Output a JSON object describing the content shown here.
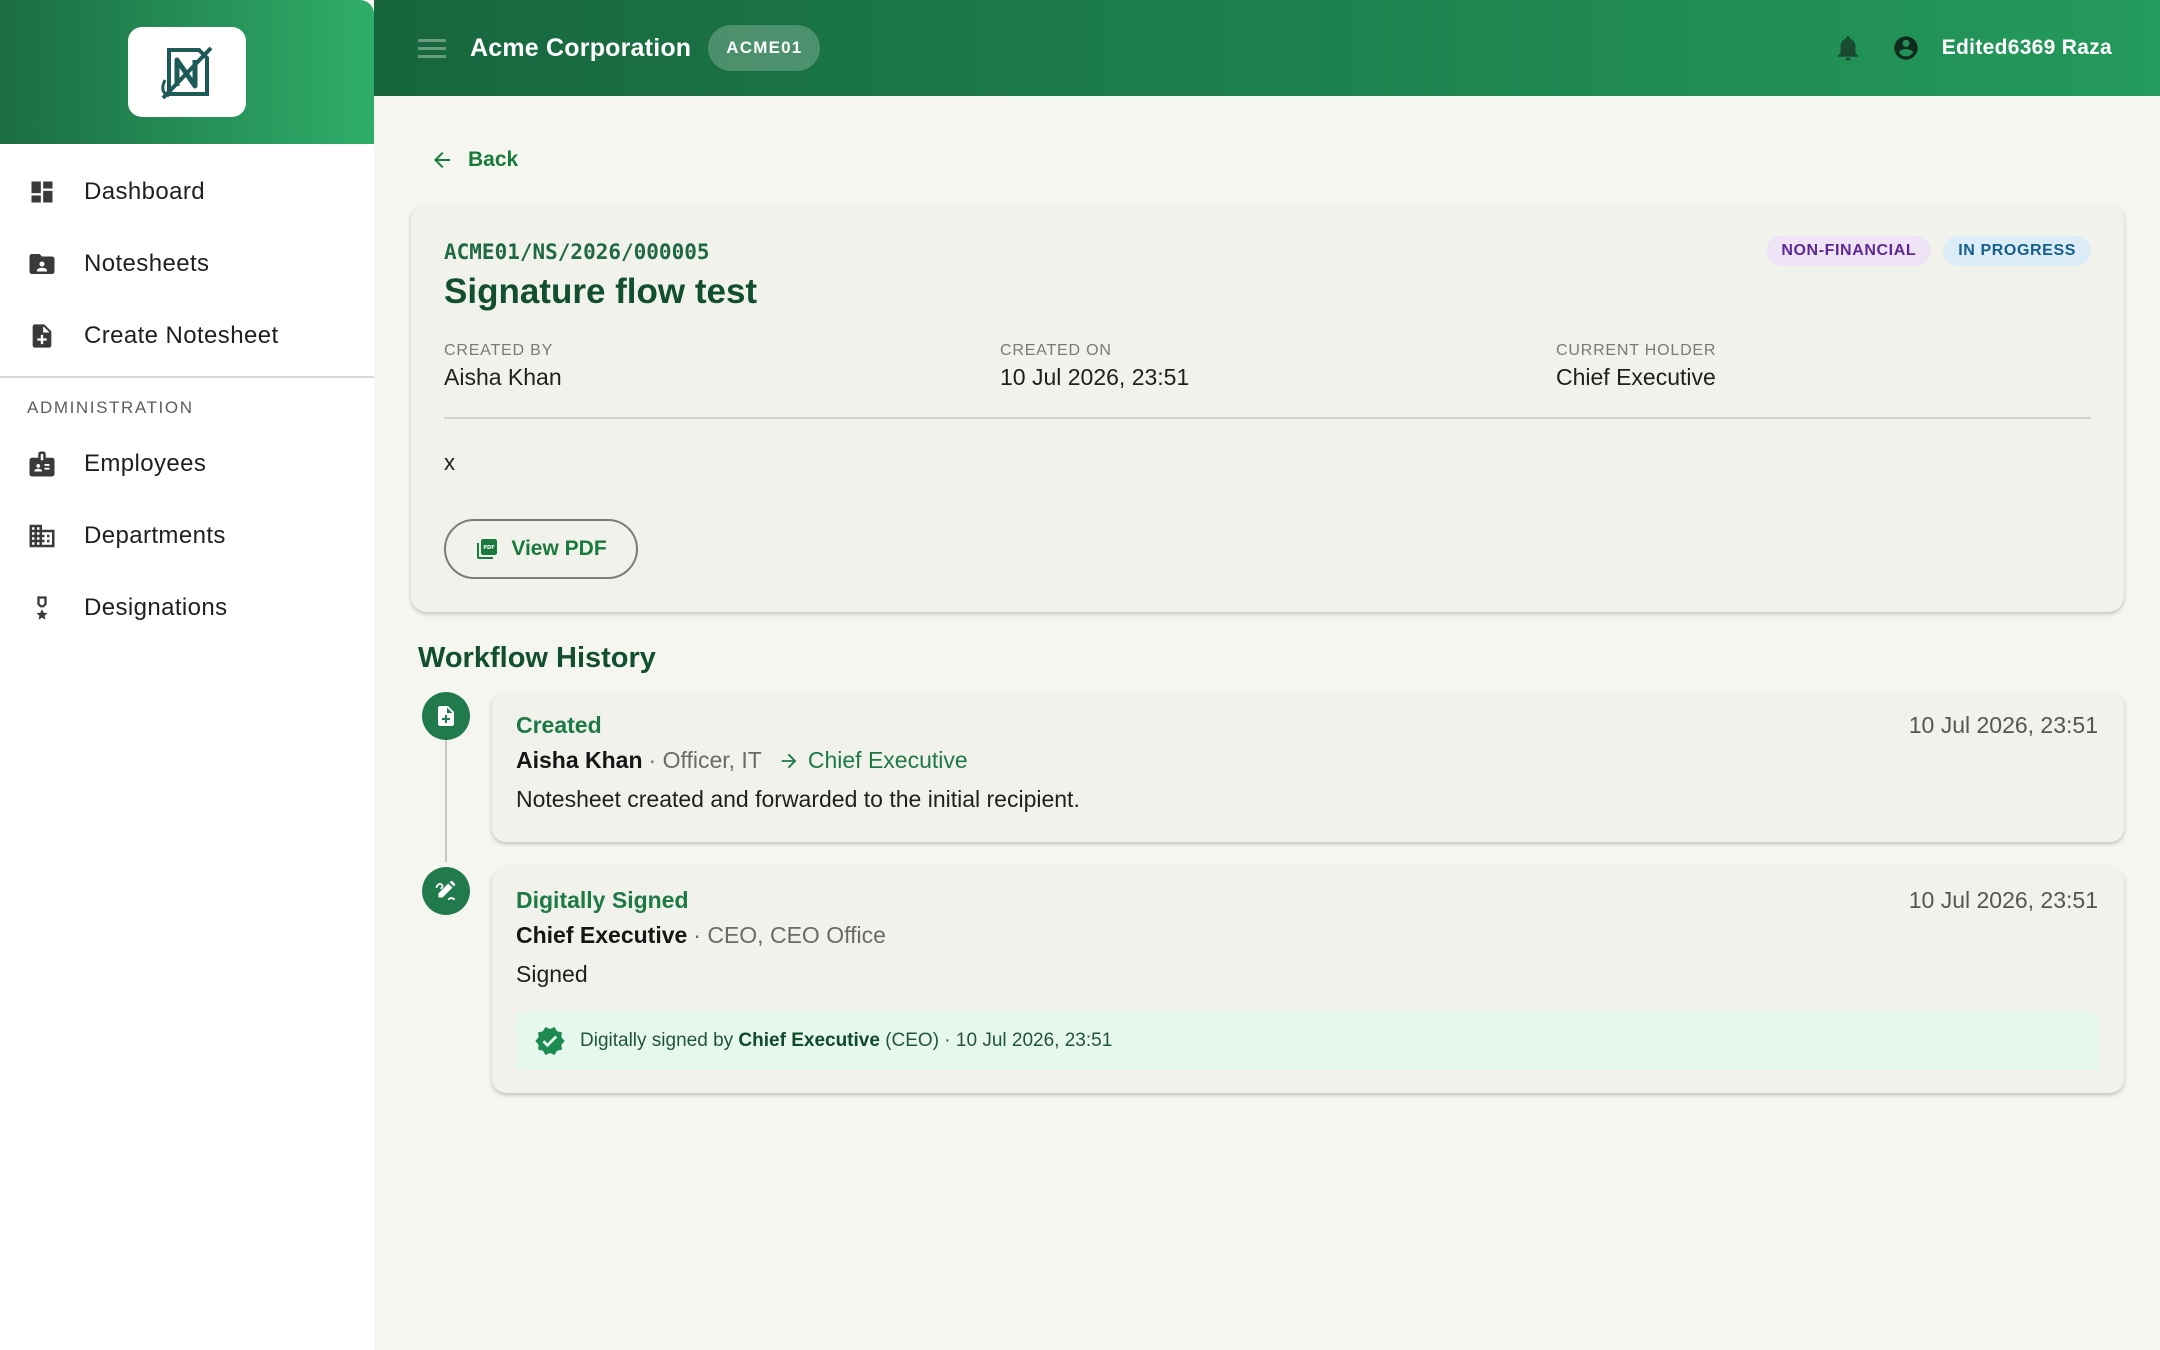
{
  "sidebar": {
    "items": [
      {
        "label": "Dashboard",
        "icon": "dashboard-icon"
      },
      {
        "label": "Notesheets",
        "icon": "folder-user-icon"
      },
      {
        "label": "Create Notesheet",
        "icon": "note-add-icon"
      }
    ],
    "section_label": "ADMINISTRATION",
    "admin_items": [
      {
        "label": "Employees",
        "icon": "badge-icon"
      },
      {
        "label": "Departments",
        "icon": "building-icon"
      },
      {
        "label": "Designations",
        "icon": "medal-icon"
      }
    ]
  },
  "topbar": {
    "org_name": "Acme Corporation",
    "org_code": "ACME01",
    "user_name": "Edited6369 Raza"
  },
  "back_label": "Back",
  "notesheet": {
    "reference": "ACME01/NS/2026/000005",
    "title": "Signature flow test",
    "badges": {
      "type": "NON-FINANCIAL",
      "status": "IN PROGRESS"
    },
    "meta": {
      "created_by_label": "CREATED BY",
      "created_by": "Aisha Khan",
      "created_on_label": "CREATED ON",
      "created_on": "10 Jul 2026, 23:51",
      "holder_label": "CURRENT HOLDER",
      "holder": "Chief Executive"
    },
    "body": "x",
    "view_pdf_label": "View PDF"
  },
  "workflow": {
    "title": "Workflow History",
    "events": [
      {
        "action": "Created",
        "time": "10 Jul 2026, 23:51",
        "actor": "Aisha Khan",
        "actor_role": "· Officer, IT",
        "forwarded_to": "Chief Executive",
        "note": "Notesheet created and forwarded to the initial recipient."
      },
      {
        "action": "Digitally Signed",
        "time": "10 Jul 2026, 23:51",
        "actor": "Chief Executive",
        "actor_role": "· CEO, CEO Office",
        "note": "Signed",
        "signature": {
          "prefix": "Digitally signed by",
          "name": "Chief Executive",
          "suffix": "(CEO) · 10 Jul 2026, 23:51"
        }
      }
    ]
  },
  "colors": {
    "brand_dark": "#17663d",
    "brand_light": "#2fad69",
    "accent_text": "#1d7a45"
  }
}
